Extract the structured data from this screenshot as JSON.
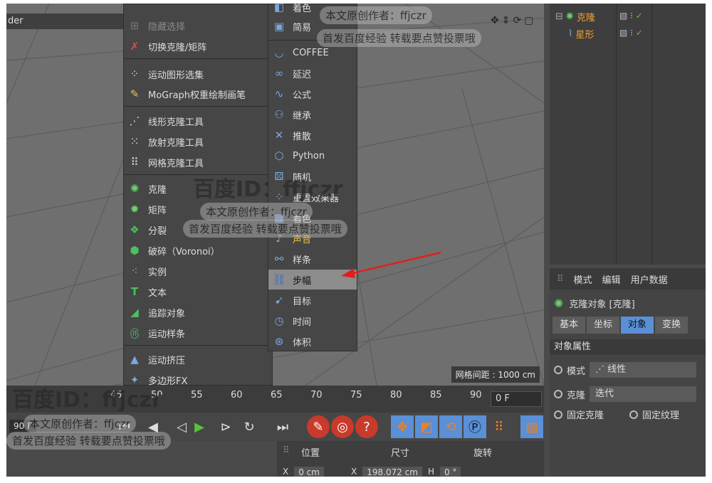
{
  "viewport": {
    "title": "der",
    "grid_spacing": "网格间距 : 1000 cm"
  },
  "menu_left": {
    "items": [
      {
        "label": "隐藏选择",
        "icon": "hide-selection-icon",
        "dim": true
      },
      {
        "label": "切换克隆/矩阵",
        "icon": "toggle-clone-matrix-icon"
      },
      {
        "label": "运动图形选集",
        "icon": "mograph-selection-icon"
      },
      {
        "label": "MoGraph权重绘制画笔",
        "icon": "weight-paint-brush-icon"
      },
      {
        "label": "线形克隆工具",
        "icon": "linear-clone-tool-icon"
      },
      {
        "label": "放射克隆工具",
        "icon": "radial-clone-tool-icon"
      },
      {
        "label": "网格克隆工具",
        "icon": "grid-clone-tool-icon"
      },
      {
        "label": "克隆",
        "icon": "cloner-icon"
      },
      {
        "label": "矩阵",
        "icon": "matrix-icon"
      },
      {
        "label": "分裂",
        "icon": "fracture-icon"
      },
      {
        "label": "破碎（Voronoi）",
        "icon": "voronoi-fracture-icon"
      },
      {
        "label": "实例",
        "icon": "instance-icon"
      },
      {
        "label": "文本",
        "icon": "text-icon"
      },
      {
        "label": "追踪对象",
        "icon": "tracer-icon"
      },
      {
        "label": "运动样条",
        "icon": "motion-spline-icon"
      },
      {
        "label": "运动挤压",
        "icon": "motion-extrude-icon"
      },
      {
        "label": "多边形FX",
        "icon": "poly-fx-icon"
      }
    ]
  },
  "menu_right": {
    "items": [
      {
        "label": "着色",
        "icon": "shader-effector-icon"
      },
      {
        "label": "简易",
        "icon": "plain-effector-icon"
      },
      {
        "label": "COFFEE",
        "icon": "coffee-effector-icon"
      },
      {
        "label": "延迟",
        "icon": "delay-effector-icon"
      },
      {
        "label": "公式",
        "icon": "formula-effector-icon"
      },
      {
        "label": "继承",
        "icon": "inheritance-effector-icon"
      },
      {
        "label": "推散",
        "icon": "push-apart-effector-icon"
      },
      {
        "label": "Python",
        "icon": "python-effector-icon"
      },
      {
        "label": "随机",
        "icon": "random-effector-icon"
      },
      {
        "label": "重置效果器",
        "icon": "reeffector-icon"
      },
      {
        "label": "着色",
        "icon": "shader-icon"
      },
      {
        "label": "声音",
        "icon": "sound-effector-icon"
      },
      {
        "label": "样条",
        "icon": "spline-effector-icon"
      },
      {
        "label": "步幅",
        "icon": "step-effector-icon",
        "selected": true
      },
      {
        "label": "目标",
        "icon": "target-effector-icon"
      },
      {
        "label": "时间",
        "icon": "time-effector-icon"
      },
      {
        "label": "体积",
        "icon": "volume-effector-icon"
      }
    ]
  },
  "object_manager": {
    "rows": [
      {
        "label": "克隆",
        "icon": "cloner-icon"
      },
      {
        "label": "星形",
        "icon": "star-spline-icon"
      }
    ]
  },
  "attributes": {
    "tabs": [
      "模式",
      "编辑",
      "用户数据"
    ],
    "title": "克隆对象 [克隆]",
    "subtabs": [
      "基本",
      "坐标",
      "对象",
      "变换"
    ],
    "active_subtab": "对象",
    "section": "对象属性",
    "mode_label": "模式",
    "mode_value": "线性",
    "clone_label": "克隆",
    "clone_value": "迭代",
    "fixed_clone": "固定克隆",
    "fixed_texture": "固定纹理"
  },
  "timeline": {
    "ticks": [
      "45",
      "50",
      "55",
      "60",
      "65",
      "70",
      "75",
      "80",
      "85",
      "90"
    ],
    "current_frame": "0 F",
    "left_field": "90 F"
  },
  "coordinates": {
    "headers": [
      "位置",
      "尺寸",
      "旋转"
    ],
    "x_label": "X",
    "x_pos": "0 cm",
    "x_size_label": "X",
    "x_size": "198.072 cm",
    "h_label": "H",
    "h_rot": "0 °"
  },
  "watermark": {
    "brand": "百度ID：ffjczr",
    "line1": "本文原创作者：ffjczr",
    "line2": "首发百度经验  转载要点赞投票哦"
  },
  "colors": {
    "accent_orange": "#f0a030",
    "selected_tab": "#5b8fd6",
    "arrow_red": "#e02020",
    "check_green": "#59c13a"
  }
}
